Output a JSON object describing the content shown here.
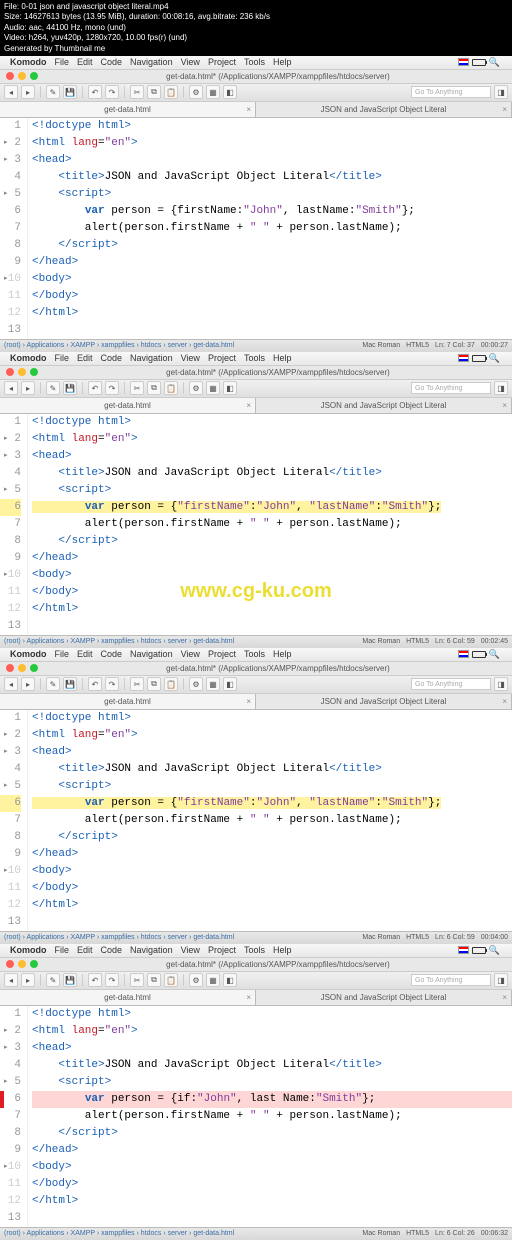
{
  "file_info": {
    "l1": "File: 0-01 json and javascript object literal.mp4",
    "l2": "Size: 14627613 bytes (13.95 MiB), duration: 00:08:16, avg.bitrate: 236 kb/s",
    "l3": "Audio: aac, 44100 Hz, mono (und)",
    "l4": "Video: h264, yuv420p, 1280x720, 10.00 fps(r) (und)",
    "l5": "Generated by Thumbnail me"
  },
  "menubar": {
    "apple": "",
    "app": "Komodo",
    "items": [
      "File",
      "Edit",
      "Code",
      "Navigation",
      "View",
      "Project",
      "Tools",
      "Help"
    ]
  },
  "window_title": "get-data.html* (/Applications/XAMPP/xamppfiles/htdocs/server)",
  "toolbar": {
    "goto": "Go To Anything"
  },
  "tabs": {
    "t1": "get-data.html",
    "t2": "JSON and JavaScript Object Literal"
  },
  "code_v1": {
    "l1": {
      "a": "<!doctype html>"
    },
    "l2": {
      "a": "<html ",
      "b": "lang",
      "c": "=",
      "d": "\"en\"",
      "e": ">"
    },
    "l3": {
      "a": "<head>"
    },
    "l4": {
      "a": "    <title>",
      "b": "JSON and JavaScript Object Literal",
      "c": "</title>"
    },
    "l5": {
      "a": "    <script>"
    },
    "l6": {
      "a": "        ",
      "b": "var",
      "c": " person = {firstName:",
      "d": "\"John\"",
      "e": ", lastName:",
      "f": "\"Smith\"",
      "g": "};"
    },
    "l7": {
      "a": "        alert(person.firstName + ",
      "b": "\" \"",
      "c": " + person.lastName);"
    },
    "l8": {
      "a": "    </script>"
    },
    "l9": {
      "a": "</head>"
    },
    "l10": {
      "a": "<body>"
    },
    "l11": {
      "a": "</body>"
    },
    "l12": {
      "a": "</html>"
    }
  },
  "code_v2": {
    "l6": {
      "a": "        ",
      "b": "var",
      "c": " person = {",
      "d": "\"firstName\"",
      "e": ":",
      "f": "\"John\"",
      "g": ", ",
      "h": "\"lastName\"",
      "i": ":",
      "j": "\"Smith\"",
      "k": "};"
    }
  },
  "code_v4": {
    "l6": {
      "a": "        ",
      "b": "var",
      "c": " person = {if:",
      "d": "\"John\"",
      "e": ", last Name:",
      "f": "\"Smith\"",
      "g": "};"
    }
  },
  "status": {
    "crumbs": "(root) › Applications › XAMPP › xamppfiles › htdocs › server › get-data.html",
    "encoding": "Mac Roman",
    "lang": "HTML5",
    "pos1": "Ln: 7 Col: 37",
    "pos2": "Ln: 6 Col: 59",
    "pos3": "Ln: 6 Col: 26",
    "time1": "00:00:27",
    "time2": "00:02:45",
    "time3": "00:04:00",
    "time4": "00:06:32"
  },
  "watermark": "www.cg-ku.com"
}
